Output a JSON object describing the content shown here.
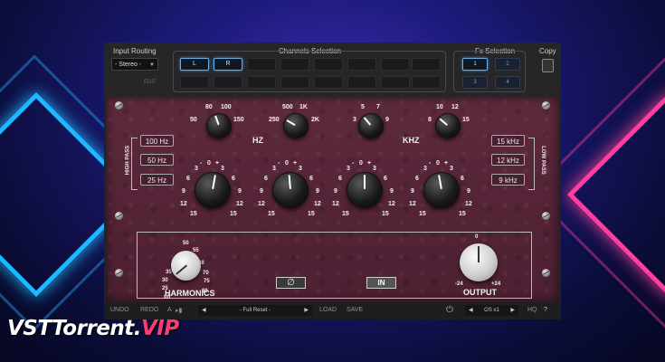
{
  "colors": {
    "panel": "#552437",
    "accent_blue": "#6ab0e8",
    "logo_red": "#ff3b6e"
  },
  "topbar": {
    "input_routing_label": "Input Routing",
    "input_routing_value": "- Stereo -",
    "edit_label": "EDIT",
    "channels_label": "Channels Selection",
    "channel_l": "L",
    "channel_r": "R",
    "fx_label": "Fx Selection",
    "fx": [
      "1",
      "2",
      "3",
      "4"
    ],
    "copy_label": "Copy"
  },
  "eq": {
    "hz_label": "HZ",
    "khz_label": "KHZ",
    "freq_knobs": [
      {
        "ticks": [
          "50",
          "80",
          "100",
          "150"
        ]
      },
      {
        "ticks": [
          "250",
          "500",
          "1K",
          "2K"
        ]
      },
      {
        "ticks": [
          "3",
          "5",
          "7",
          "9"
        ]
      },
      {
        "ticks": [
          "8",
          "10",
          "12",
          "15"
        ]
      }
    ],
    "gain_ticks": [
      "0",
      "3",
      "6",
      "9",
      "12",
      "15",
      "-",
      "+"
    ],
    "high_pass_label": "HIGH PASS",
    "high_pass": [
      "100 Hz",
      "50 Hz",
      "25 Hz"
    ],
    "low_pass_label": "LOW PASS",
    "low_pass": [
      "15 kHz",
      "12 kHz",
      "9 kHz"
    ]
  },
  "harmonics": {
    "label": "HARMONICS",
    "ticks": [
      "0ff",
      "25",
      "30",
      "35",
      "40",
      "45",
      "50",
      "55",
      "60",
      "70",
      "75",
      "80"
    ]
  },
  "phase_symbol": "∅",
  "in_label": "IN",
  "output": {
    "label": "OUTPUT",
    "ticks": [
      "0",
      "-24",
      "+24"
    ]
  },
  "bottombar": {
    "undo": "UNDO",
    "redo": "REDO",
    "ab": "A",
    "preset": "- Full Reset -",
    "load": "LOAD",
    "save": "SAVE",
    "os": "OS x1",
    "hq": "HQ",
    "help": "?"
  },
  "logo": {
    "main": "VSTTorrent.",
    "vip": "VIP"
  }
}
